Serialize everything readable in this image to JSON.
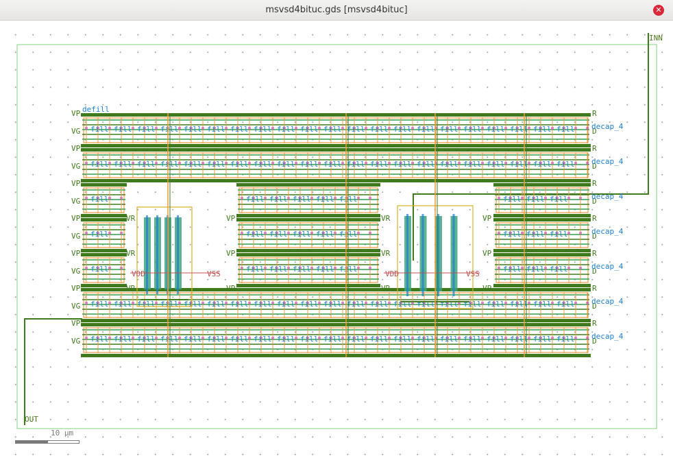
{
  "window": {
    "title": "msvsd4bituc.gds [msvsd4bituc]",
    "close_icon": "close-icon"
  },
  "pins": {
    "input": "INN",
    "output": "OUT"
  },
  "scale": {
    "label": "10 μm"
  },
  "cell_labels": {
    "decap": "decap_4",
    "fill": "fill",
    "vpwr": "VP",
    "vgnd": "VG",
    "vdd": "VDD",
    "vss": "VSS"
  },
  "colors": {
    "boundary": "#7fd37f",
    "metal_green": "#3f7a1d",
    "label_blue": "#1e7fd0",
    "orange": "#e89a3c",
    "magenta": "#c040c0",
    "pin": "#4b7a1c"
  }
}
